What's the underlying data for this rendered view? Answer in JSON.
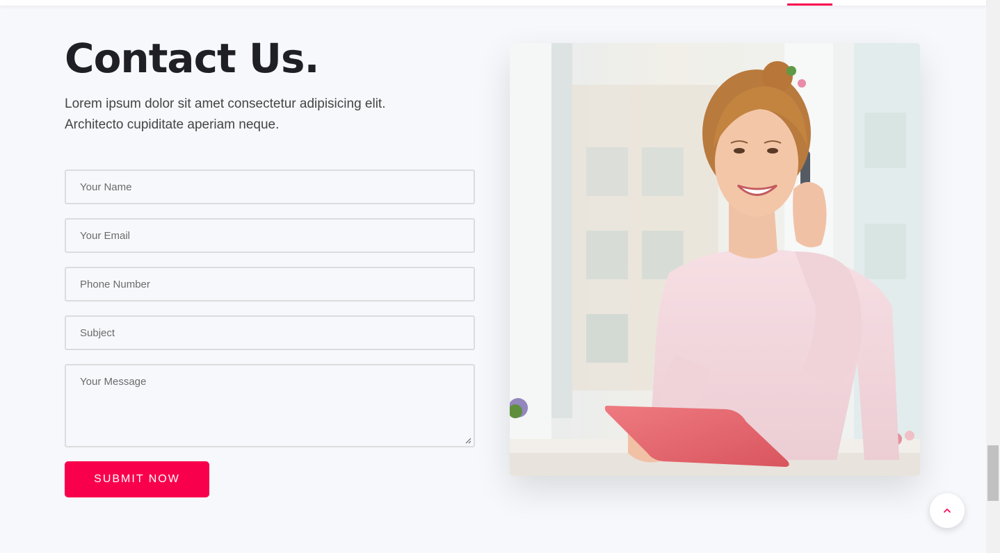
{
  "header": {
    "accent_color": "#f9004d"
  },
  "contact": {
    "title": "Contact Us.",
    "description_line1": "Lorem ipsum dolor sit amet consectetur adipisicing elit.",
    "description_line2": "Architecto cupiditate aperiam neque."
  },
  "form": {
    "name_placeholder": "Your Name",
    "email_placeholder": "Your Email",
    "phone_placeholder": "Phone Number",
    "subject_placeholder": "Subject",
    "message_placeholder": "Your Message",
    "submit_label": "SUBMIT NOW",
    "submit_color": "#f9004d"
  },
  "image": {
    "subject": "woman-on-phone-holding-tablet"
  },
  "icons": {
    "scroll_top": "chevron-up-icon"
  }
}
